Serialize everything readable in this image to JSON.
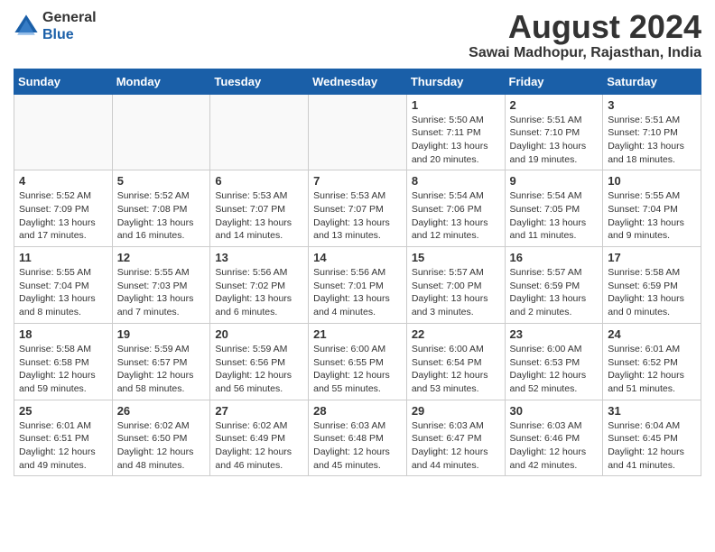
{
  "header": {
    "logo_line1": "General",
    "logo_line2": "Blue",
    "month_year": "August 2024",
    "location": "Sawai Madhopur, Rajasthan, India"
  },
  "weekdays": [
    "Sunday",
    "Monday",
    "Tuesday",
    "Wednesday",
    "Thursday",
    "Friday",
    "Saturday"
  ],
  "weeks": [
    [
      {
        "day": "",
        "info": ""
      },
      {
        "day": "",
        "info": ""
      },
      {
        "day": "",
        "info": ""
      },
      {
        "day": "",
        "info": ""
      },
      {
        "day": "1",
        "info": "Sunrise: 5:50 AM\nSunset: 7:11 PM\nDaylight: 13 hours\nand 20 minutes."
      },
      {
        "day": "2",
        "info": "Sunrise: 5:51 AM\nSunset: 7:10 PM\nDaylight: 13 hours\nand 19 minutes."
      },
      {
        "day": "3",
        "info": "Sunrise: 5:51 AM\nSunset: 7:10 PM\nDaylight: 13 hours\nand 18 minutes."
      }
    ],
    [
      {
        "day": "4",
        "info": "Sunrise: 5:52 AM\nSunset: 7:09 PM\nDaylight: 13 hours\nand 17 minutes."
      },
      {
        "day": "5",
        "info": "Sunrise: 5:52 AM\nSunset: 7:08 PM\nDaylight: 13 hours\nand 16 minutes."
      },
      {
        "day": "6",
        "info": "Sunrise: 5:53 AM\nSunset: 7:07 PM\nDaylight: 13 hours\nand 14 minutes."
      },
      {
        "day": "7",
        "info": "Sunrise: 5:53 AM\nSunset: 7:07 PM\nDaylight: 13 hours\nand 13 minutes."
      },
      {
        "day": "8",
        "info": "Sunrise: 5:54 AM\nSunset: 7:06 PM\nDaylight: 13 hours\nand 12 minutes."
      },
      {
        "day": "9",
        "info": "Sunrise: 5:54 AM\nSunset: 7:05 PM\nDaylight: 13 hours\nand 11 minutes."
      },
      {
        "day": "10",
        "info": "Sunrise: 5:55 AM\nSunset: 7:04 PM\nDaylight: 13 hours\nand 9 minutes."
      }
    ],
    [
      {
        "day": "11",
        "info": "Sunrise: 5:55 AM\nSunset: 7:04 PM\nDaylight: 13 hours\nand 8 minutes."
      },
      {
        "day": "12",
        "info": "Sunrise: 5:55 AM\nSunset: 7:03 PM\nDaylight: 13 hours\nand 7 minutes."
      },
      {
        "day": "13",
        "info": "Sunrise: 5:56 AM\nSunset: 7:02 PM\nDaylight: 13 hours\nand 6 minutes."
      },
      {
        "day": "14",
        "info": "Sunrise: 5:56 AM\nSunset: 7:01 PM\nDaylight: 13 hours\nand 4 minutes."
      },
      {
        "day": "15",
        "info": "Sunrise: 5:57 AM\nSunset: 7:00 PM\nDaylight: 13 hours\nand 3 minutes."
      },
      {
        "day": "16",
        "info": "Sunrise: 5:57 AM\nSunset: 6:59 PM\nDaylight: 13 hours\nand 2 minutes."
      },
      {
        "day": "17",
        "info": "Sunrise: 5:58 AM\nSunset: 6:59 PM\nDaylight: 13 hours\nand 0 minutes."
      }
    ],
    [
      {
        "day": "18",
        "info": "Sunrise: 5:58 AM\nSunset: 6:58 PM\nDaylight: 12 hours\nand 59 minutes."
      },
      {
        "day": "19",
        "info": "Sunrise: 5:59 AM\nSunset: 6:57 PM\nDaylight: 12 hours\nand 58 minutes."
      },
      {
        "day": "20",
        "info": "Sunrise: 5:59 AM\nSunset: 6:56 PM\nDaylight: 12 hours\nand 56 minutes."
      },
      {
        "day": "21",
        "info": "Sunrise: 6:00 AM\nSunset: 6:55 PM\nDaylight: 12 hours\nand 55 minutes."
      },
      {
        "day": "22",
        "info": "Sunrise: 6:00 AM\nSunset: 6:54 PM\nDaylight: 12 hours\nand 53 minutes."
      },
      {
        "day": "23",
        "info": "Sunrise: 6:00 AM\nSunset: 6:53 PM\nDaylight: 12 hours\nand 52 minutes."
      },
      {
        "day": "24",
        "info": "Sunrise: 6:01 AM\nSunset: 6:52 PM\nDaylight: 12 hours\nand 51 minutes."
      }
    ],
    [
      {
        "day": "25",
        "info": "Sunrise: 6:01 AM\nSunset: 6:51 PM\nDaylight: 12 hours\nand 49 minutes."
      },
      {
        "day": "26",
        "info": "Sunrise: 6:02 AM\nSunset: 6:50 PM\nDaylight: 12 hours\nand 48 minutes."
      },
      {
        "day": "27",
        "info": "Sunrise: 6:02 AM\nSunset: 6:49 PM\nDaylight: 12 hours\nand 46 minutes."
      },
      {
        "day": "28",
        "info": "Sunrise: 6:03 AM\nSunset: 6:48 PM\nDaylight: 12 hours\nand 45 minutes."
      },
      {
        "day": "29",
        "info": "Sunrise: 6:03 AM\nSunset: 6:47 PM\nDaylight: 12 hours\nand 44 minutes."
      },
      {
        "day": "30",
        "info": "Sunrise: 6:03 AM\nSunset: 6:46 PM\nDaylight: 12 hours\nand 42 minutes."
      },
      {
        "day": "31",
        "info": "Sunrise: 6:04 AM\nSunset: 6:45 PM\nDaylight: 12 hours\nand 41 minutes."
      }
    ]
  ]
}
